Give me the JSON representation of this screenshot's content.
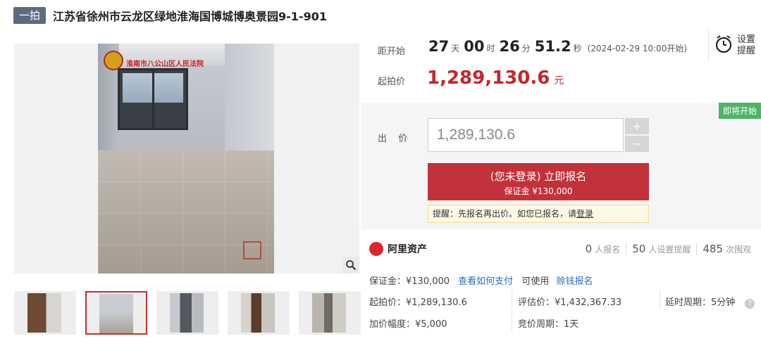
{
  "header": {
    "auction_type": "一拍",
    "title": "江苏省徐州市云龙区绿地淮海国博城博奥景园9-1-901"
  },
  "gallery": {
    "watermark_court": "淮南市八公山区人民法院",
    "thumbnail_count": 5,
    "active_thumbnail": 2
  },
  "countdown": {
    "label": "距开始",
    "days": "27",
    "days_unit": "天",
    "hours": "00",
    "hours_unit": "时",
    "minutes": "26",
    "minutes_unit": "分",
    "seconds": "51.2",
    "seconds_unit": "秒",
    "start_text": "(2024-02-29 10:00开始)"
  },
  "start_price": {
    "label": "起拍价",
    "value": "1,289,130.6",
    "unit": "元"
  },
  "reminder": {
    "label": "设置提醒"
  },
  "bid": {
    "status_badge": "即将开始",
    "label": "出 价",
    "input_value": "1,289,130.6",
    "plus": "+",
    "minus": "−",
    "signup_line1": "(您未登录) 立即报名",
    "signup_line2": "保证金 ¥130,000",
    "tip_text": "提醒：先报名再出价。如您已报名，请",
    "tip_link": "登录"
  },
  "platform": {
    "name": "阿里资产",
    "signup_count": "0",
    "signup_label": "人报名",
    "reminder_count": "50",
    "reminder_label": "人设置提醒",
    "views_count": "485",
    "views_label": "次围观"
  },
  "details": {
    "deposit": "保证金：¥130,000",
    "how_to_pay": "查看如何支付",
    "usable": "可使用",
    "credit_signup": "赊钱报名",
    "start_price": "起拍价：¥1,289,130.6",
    "appraisal": "评估价：¥1,432,367.33",
    "delay_period": "延时周期：5分钟",
    "increment": "加价幅度：¥5,000",
    "bidding_period": "竞价周期：1天"
  },
  "colors": {
    "accent_red": "#c6262d",
    "badge_green": "#4eb568",
    "link_blue": "#2d6bbf"
  }
}
